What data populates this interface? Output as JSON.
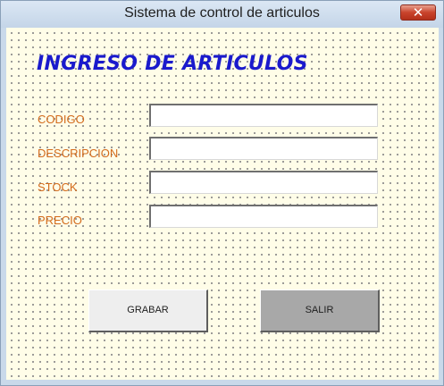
{
  "window": {
    "title": "Sistema de control de articulos",
    "close_icon": "close-icon",
    "close_glyph": "✕"
  },
  "form": {
    "heading": "INGRESO DE ARTICULOS",
    "fields": [
      {
        "label": "CODIGO",
        "value": ""
      },
      {
        "label": "DESCRIPCION",
        "value": ""
      },
      {
        "label": "STOCK",
        "value": ""
      },
      {
        "label": "PRECIO",
        "value": ""
      }
    ]
  },
  "buttons": {
    "grabar": "GRABAR",
    "salir": "SALIR"
  },
  "colors": {
    "heading": "#1a1acc",
    "labels": "#d36b1c",
    "form_background": "#fffde8"
  }
}
